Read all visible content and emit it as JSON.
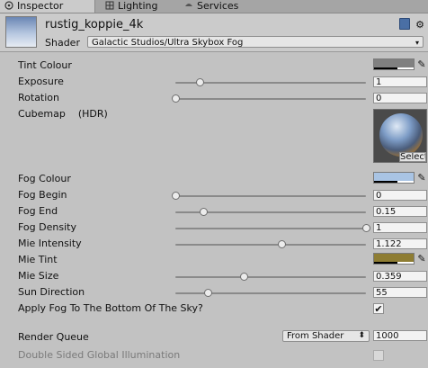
{
  "tabs": [
    {
      "label": "Inspector",
      "icon": "inspector-icon",
      "active": true
    },
    {
      "label": "Lighting",
      "icon": "lighting-icon",
      "active": false
    },
    {
      "label": "Services",
      "icon": "services-icon",
      "active": false
    }
  ],
  "material": {
    "name": "rustig_koppie_4k",
    "shader_label": "Shader",
    "shader_value": "Galactic Studios/Ultra Skybox Fog"
  },
  "properties": {
    "tint_colour": {
      "label": "Tint Colour",
      "color": "#808080"
    },
    "exposure": {
      "label": "Exposure",
      "value": "1",
      "fraction": 0.13
    },
    "rotation": {
      "label": "Rotation",
      "value": "0",
      "fraction": 0.0
    },
    "cubemap": {
      "label": "Cubemap",
      "hint": "(HDR)",
      "select_label": "Select"
    },
    "fog_colour": {
      "label": "Fog Colour",
      "color": "#a9c4e4"
    },
    "fog_begin": {
      "label": "Fog Begin",
      "value": "0",
      "fraction": 0.0
    },
    "fog_end": {
      "label": "Fog End",
      "value": "0.15",
      "fraction": 0.15
    },
    "fog_density": {
      "label": "Fog Density",
      "value": "1",
      "fraction": 1.0
    },
    "mie_intensity": {
      "label": "Mie Intensity",
      "value": "1.122",
      "fraction": 0.56
    },
    "mie_tint": {
      "label": "Mie Tint",
      "color": "#8e7d33"
    },
    "mie_size": {
      "label": "Mie Size",
      "value": "0.359",
      "fraction": 0.36
    },
    "sun_direction": {
      "label": "Sun Direction",
      "value": "55",
      "fraction": 0.17
    },
    "apply_fog_bottom": {
      "label": "Apply Fog To The Bottom Of The Sky?",
      "checked": true
    }
  },
  "render_queue": {
    "label": "Render Queue",
    "dropdown": "From Shader",
    "value": "1000"
  },
  "double_sided_gi": {
    "label": "Double Sided Global Illumination",
    "checked": false
  }
}
